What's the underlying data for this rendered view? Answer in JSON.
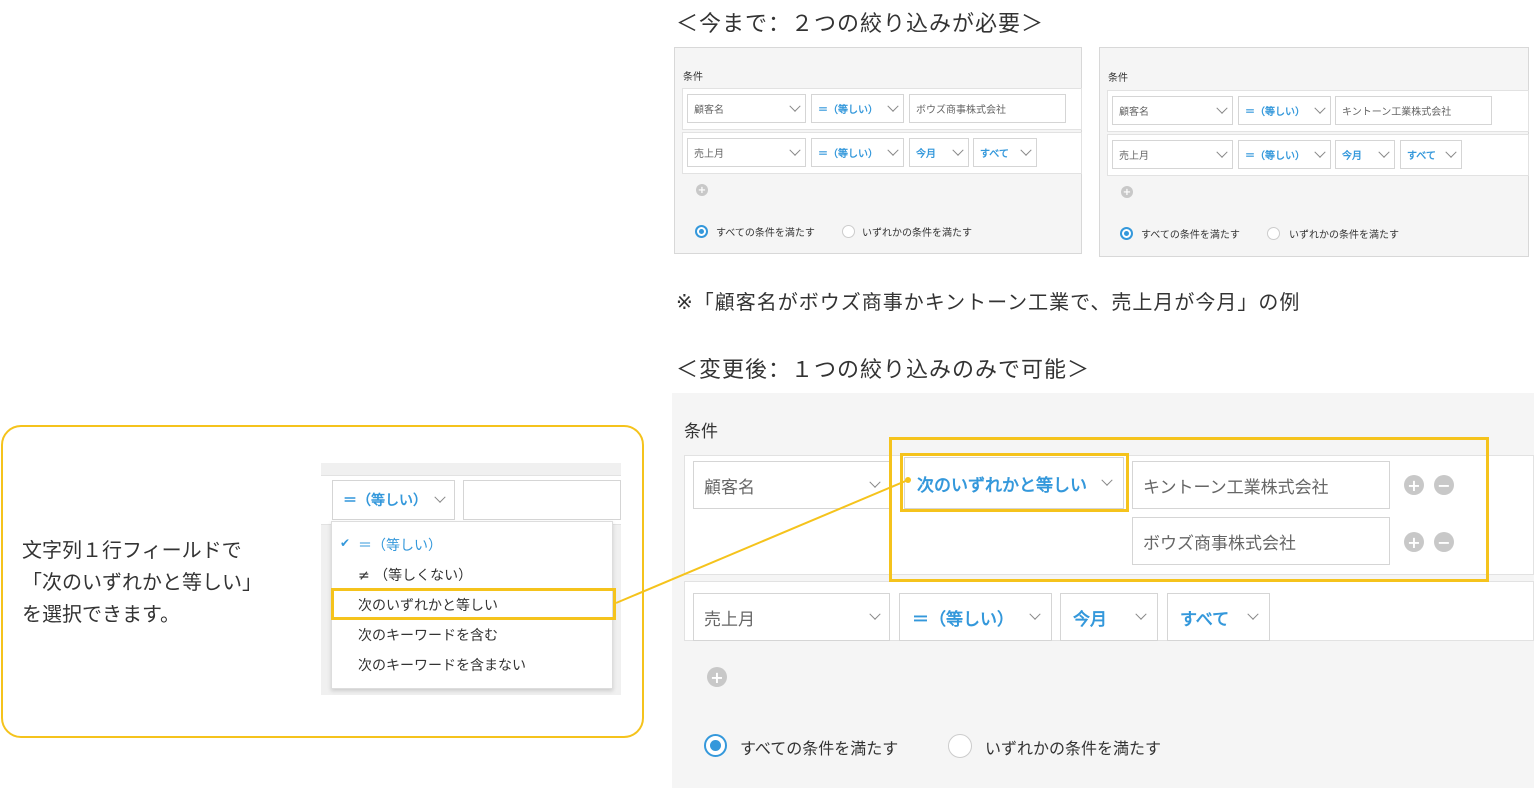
{
  "headings": {
    "before": "＜今まで：２つの絞り込みが必要＞",
    "note": "※「顧客名がボウズ商事かキントーン工業で、売上月が今月」の例",
    "after": "＜変更後：１つの絞り込みのみで可能＞"
  },
  "panel_left": {
    "title": "条件",
    "field1": "顧客名",
    "op1": "＝（等しい）",
    "value1": "ボウズ商事株式会社",
    "field2": "売上月",
    "op2": "＝（等しい）",
    "month": "今月",
    "scope": "すべて",
    "radio_all": "すべての条件を満たす",
    "radio_any": "いずれかの条件を満たす"
  },
  "panel_right": {
    "title": "条件",
    "field1": "顧客名",
    "op1": "＝（等しい）",
    "value1": "キントーン工業株式会社",
    "field2": "売上月",
    "op2": "＝（等しい）",
    "month": "今月",
    "scope": "すべて",
    "radio_all": "すべての条件を満たす",
    "radio_any": "いずれかの条件を満たす"
  },
  "panel_big": {
    "title": "条件",
    "field1": "顧客名",
    "op1": "次のいずれかと等しい",
    "value1": "キントーン工業株式会社",
    "value2": "ボウズ商事株式会社",
    "field2": "売上月",
    "op2": "＝（等しい）",
    "month": "今月",
    "scope": "すべて",
    "radio_all": "すべての条件を満たす",
    "radio_any": "いずれかの条件を満たす"
  },
  "callout": {
    "line1": "文字列１行フィールドで",
    "line2": "「次のいずれかと等しい」",
    "line3": "を選択できます。",
    "select_value": "＝（等しい）",
    "options": [
      "＝（等しい）",
      "≠ （等しくない）",
      "次のいずれかと等しい",
      "次のキーワードを含む",
      "次のキーワードを含まない"
    ],
    "check": "✔"
  },
  "colors": {
    "accent": "#3498db",
    "highlight": "#f5c31c"
  },
  "icons": {
    "add": "+",
    "remove": "−"
  }
}
